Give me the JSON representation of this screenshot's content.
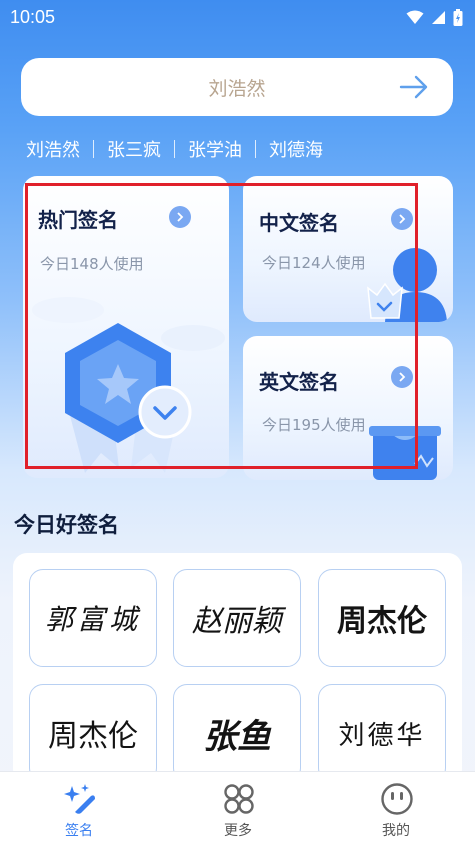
{
  "status": {
    "time": "10:05"
  },
  "search": {
    "text": "刘浩然"
  },
  "history": [
    "刘浩然",
    "张三疯",
    "张学油",
    "刘德海"
  ],
  "cards": {
    "hot": {
      "title": "热门签名",
      "sub": "今日148人使用"
    },
    "chinese": {
      "title": "中文签名",
      "sub": "今日124人使用"
    },
    "english": {
      "title": "英文签名",
      "sub": "今日195人使用"
    }
  },
  "section": {
    "title": "今日好签名"
  },
  "signatures": [
    "郭富城",
    "赵丽颖",
    "周杰伦",
    "周杰伦",
    "张鱼",
    "刘德华"
  ],
  "tabs": [
    {
      "label": "签名",
      "icon": "sparkle-icon"
    },
    {
      "label": "更多",
      "icon": "grid-icon"
    },
    {
      "label": "我的",
      "icon": "smiley-icon"
    }
  ],
  "colors": {
    "accent": "#3a7ff0",
    "highlight": "#e0202a"
  }
}
